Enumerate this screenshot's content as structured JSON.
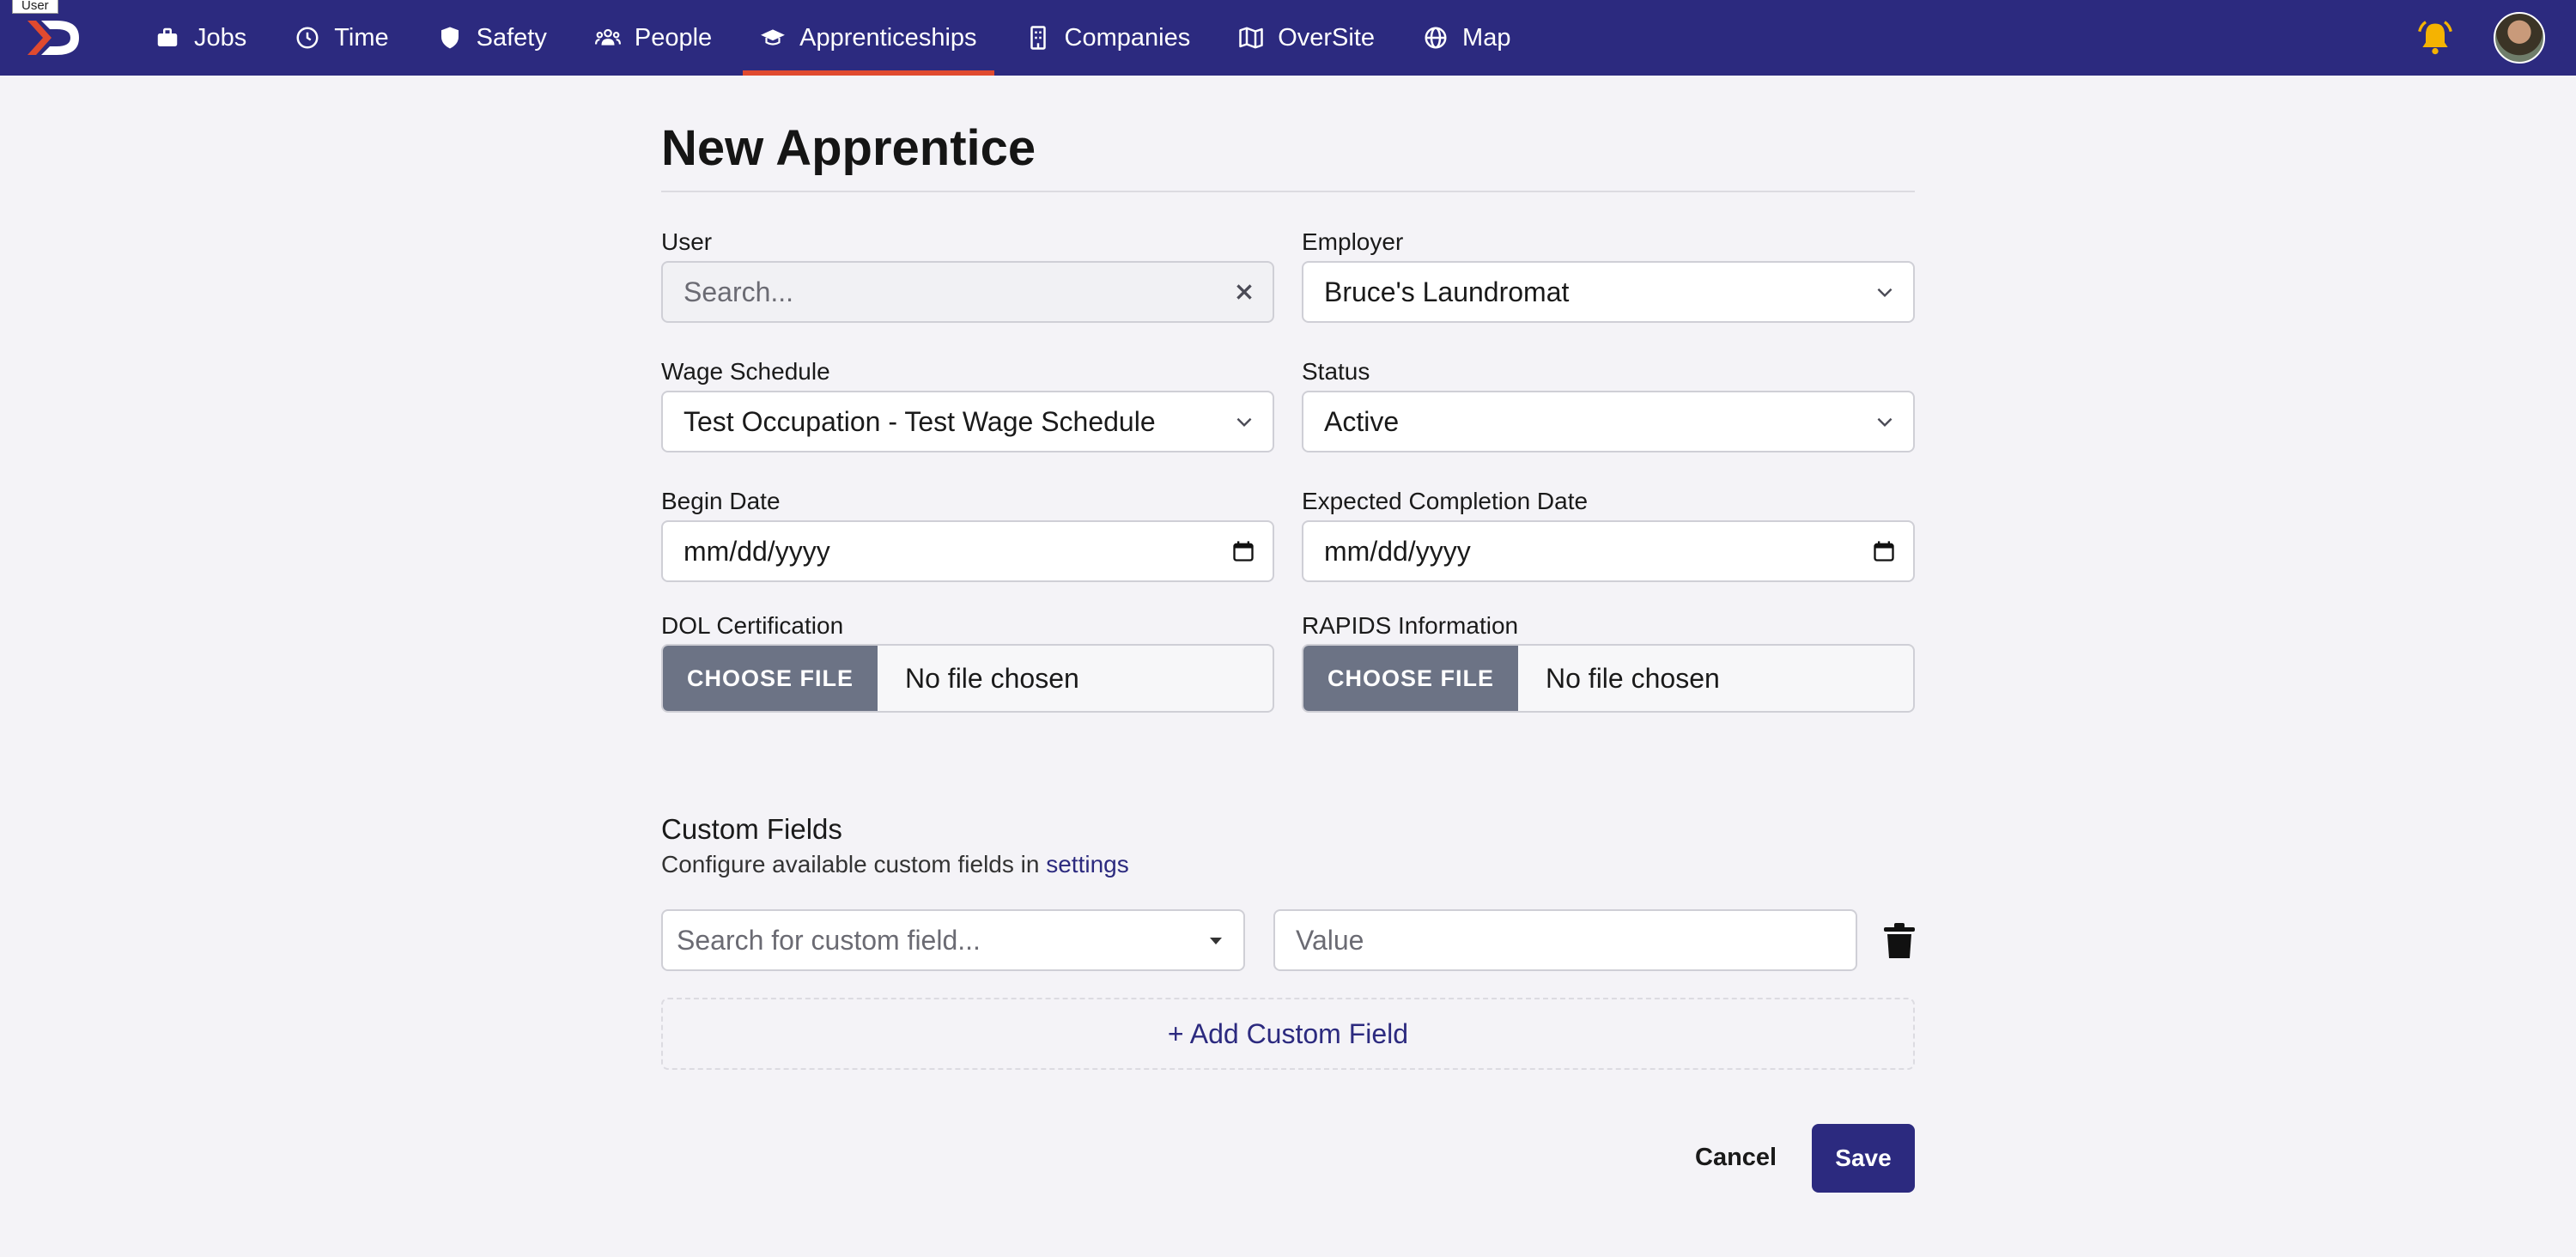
{
  "tooltip": "User",
  "nav": {
    "items": [
      {
        "label": "Jobs",
        "icon": "briefcase-icon"
      },
      {
        "label": "Time",
        "icon": "clock-icon"
      },
      {
        "label": "Safety",
        "icon": "shield-icon"
      },
      {
        "label": "People",
        "icon": "people-icon"
      },
      {
        "label": "Apprenticeships",
        "icon": "graduation-cap-icon",
        "active": true
      },
      {
        "label": "Companies",
        "icon": "building-icon"
      },
      {
        "label": "OverSite",
        "icon": "map-folded-icon"
      },
      {
        "label": "Map",
        "icon": "globe-icon"
      }
    ]
  },
  "colors": {
    "nav_bg": "#2c2a7f",
    "active_underline": "#e04a2f",
    "bell": "#f5b301",
    "primary": "#2c2a7f"
  },
  "page": {
    "title": "New Apprentice"
  },
  "form": {
    "user": {
      "label": "User",
      "placeholder": "Search..."
    },
    "employer": {
      "label": "Employer",
      "value": "Bruce's Laundromat"
    },
    "wage_schedule": {
      "label": "Wage Schedule",
      "value": "Test Occupation - Test Wage Schedule"
    },
    "status": {
      "label": "Status",
      "value": "Active"
    },
    "begin_date": {
      "label": "Begin Date",
      "placeholder": "mm/dd/yyyy"
    },
    "expected_completion": {
      "label": "Expected Completion Date",
      "placeholder": "mm/dd/yyyy"
    },
    "dol_certification": {
      "label": "DOL Certification",
      "button": "CHOOSE FILE",
      "status": "No file chosen"
    },
    "rapids_information": {
      "label": "RAPIDS Information",
      "button": "CHOOSE FILE",
      "status": "No file chosen"
    }
  },
  "custom_fields": {
    "title": "Custom Fields",
    "description": "Configure available custom fields in",
    "settings_link": "settings",
    "search_placeholder": "Search for custom field...",
    "value_placeholder": "Value",
    "add_label": "+ Add Custom Field"
  },
  "actions": {
    "cancel": "Cancel",
    "save": "Save"
  }
}
